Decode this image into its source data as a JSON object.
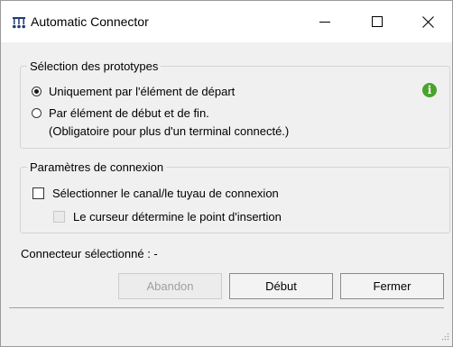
{
  "window": {
    "title": "Automatic Connector",
    "controls": {
      "minimize": "minimize-icon",
      "maximize": "maximize-icon",
      "close": "close-icon"
    }
  },
  "prototypes": {
    "legend": "Sélection des prototypes",
    "option1": "Uniquement par l'élément de départ",
    "option2": "Par élément de début et de fin.",
    "option2_note": "(Obligatoire pour plus d'un terminal connecté.)",
    "selected": "option1"
  },
  "connection": {
    "legend": "Paramètres de connexion",
    "select_channel": "Sélectionner le canal/le tuyau de connexion",
    "cursor_insert": "Le curseur détermine le point d'insertion"
  },
  "status": {
    "selected_connector": "Connecteur sélectionné : -"
  },
  "buttons": {
    "abandon": "Abandon",
    "start": "Début",
    "close": "Fermer"
  },
  "colors": {
    "info": "#4aa32e",
    "window_bg": "#f0f0f0",
    "titlebar_bg": "#ffffff"
  }
}
